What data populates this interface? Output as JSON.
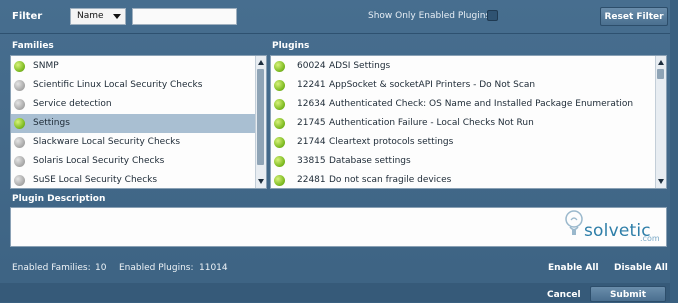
{
  "filter": {
    "label": "Filter",
    "select_value": "Name",
    "input_value": "",
    "show_only_label": "Show Only Enabled Plugins",
    "reset_label": "Reset Filter"
  },
  "families": {
    "title": "Families",
    "items": [
      {
        "label": "SNMP",
        "status": "enabled"
      },
      {
        "label": "Scientific Linux Local Security Checks",
        "status": "disabled"
      },
      {
        "label": "Service detection",
        "status": "disabled"
      },
      {
        "label": "Settings",
        "status": "enabled",
        "selected": true
      },
      {
        "label": "Slackware Local Security Checks",
        "status": "disabled"
      },
      {
        "label": "Solaris Local Security Checks",
        "status": "disabled"
      },
      {
        "label": "SuSE Local Security Checks",
        "status": "disabled"
      }
    ]
  },
  "plugins": {
    "title": "Plugins",
    "items": [
      {
        "id": "60024",
        "label": "ADSI Settings",
        "status": "enabled"
      },
      {
        "id": "12241",
        "label": "AppSocket & socketAPI Printers - Do Not Scan",
        "status": "enabled"
      },
      {
        "id": "12634",
        "label": "Authenticated Check: OS Name and Installed Package Enumeration",
        "status": "enabled"
      },
      {
        "id": "21745",
        "label": "Authentication Failure - Local Checks Not Run",
        "status": "enabled"
      },
      {
        "id": "21744",
        "label": "Cleartext protocols settings",
        "status": "enabled"
      },
      {
        "id": "33815",
        "label": "Database settings",
        "status": "enabled"
      },
      {
        "id": "22481",
        "label": "Do not scan fragile devices",
        "status": "enabled"
      }
    ]
  },
  "description": {
    "title": "Plugin Description",
    "logo_word": "solvetic",
    "logo_domain": ".com"
  },
  "footer": {
    "enabled_families_label": "Enabled Families:",
    "enabled_families_value": "10",
    "enabled_plugins_label": "Enabled Plugins:",
    "enabled_plugins_value": "11014",
    "enable_all_label": "Enable All",
    "disable_all_label": "Disable All",
    "cancel_label": "Cancel",
    "submit_label": "Submit"
  },
  "colors": {
    "background": "#476e8f",
    "enabled_dot": "#7dba21",
    "disabled_dot": "#a9a9a9",
    "selected_row": "#a9bfd2"
  }
}
